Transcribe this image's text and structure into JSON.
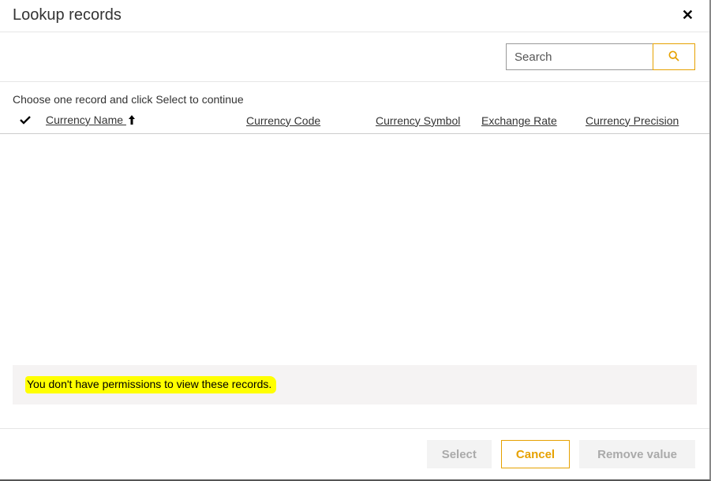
{
  "header": {
    "title": "Lookup records"
  },
  "search": {
    "placeholder": "Search"
  },
  "instruction": "Choose one record and click Select to continue",
  "columns": {
    "name": "Currency Name",
    "code": "Currency Code",
    "symbol": "Currency Symbol",
    "rate": "Exchange Rate",
    "precision": "Currency Precision"
  },
  "message": "You don't have permissions to view these records.",
  "footer": {
    "select": "Select",
    "cancel": "Cancel",
    "remove": "Remove value"
  }
}
